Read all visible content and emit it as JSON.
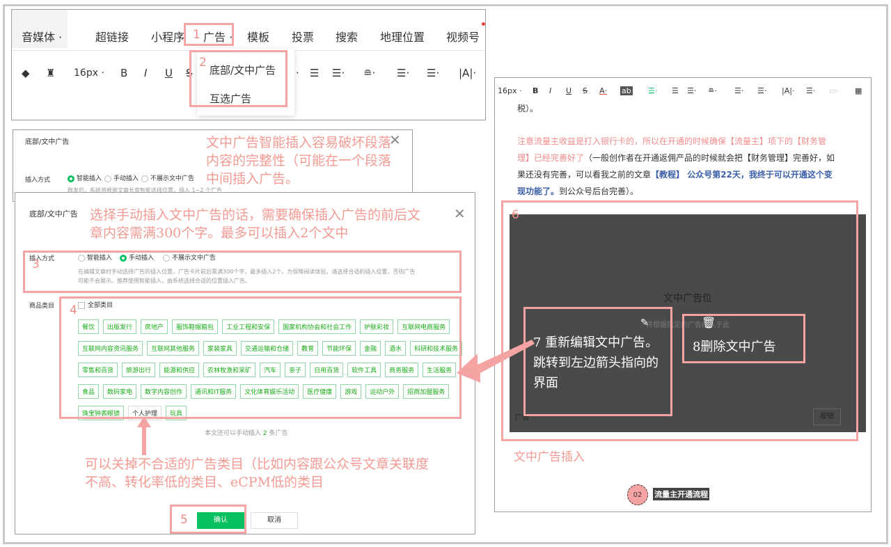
{
  "toolbar_top": {
    "menu": [
      "音媒体 ·",
      "超链接",
      "小程序",
      "广告 ·",
      "模板",
      "投票",
      "搜索",
      "地理位置",
      "视频号"
    ],
    "font_size": "16px ·",
    "bold": "B",
    "italic": "I",
    "underline": "U",
    "strike": "S"
  },
  "ad_dropdown": {
    "items": [
      "底部/文中广告",
      "互选广告"
    ]
  },
  "dialog_small": {
    "title": "底部/文中广告",
    "insert_label": "插入方式",
    "options": [
      "智能插入",
      "手动插入",
      "不展示文中广告"
    ],
    "hint": "群发后，系统将根据文章长度智能选择位置，插入 1~2 个广告"
  },
  "dialog_big": {
    "title": "底部/文中广告",
    "insert_label": "插入方式",
    "options": [
      "智能插入",
      "手动插入",
      "不展示文中广告"
    ],
    "hint_line1": "在编辑文章时手动选择广告的插入位置，广告卡片前后需满300个字，最多插入2个。为保障阅读体验，请选择合适的插入位置，否则广告",
    "hint_line2": "可能不会展示。推荐使用智能插入，由系统选择合适的位置插入广告。",
    "category_label": "商品类目",
    "all_categories": "全部类目",
    "tags": [
      [
        "餐饮",
        "出版发行",
        "房地产",
        "服饰鞋帽箱包",
        "工业工程和安保",
        "国家机构协会和社会工作",
        "护肤彩妆",
        "互联网电商服务"
      ],
      [
        "互联网内容资讯服务",
        "互联网其他服务",
        "家装家具",
        "交通运输和仓储",
        "教育",
        "节能环保",
        "金融",
        "酒水",
        "科研和技术服务"
      ],
      [
        "零售和百货",
        "旅游出行",
        "能源和供应",
        "农林牧渔和采矿",
        "汽车",
        "亲子",
        "日用百货",
        "软件工具",
        "商务服务",
        "生活服务"
      ],
      [
        "食品",
        "数码家电",
        "数字内容创作",
        "通讯和IT服务",
        "文化体育娱乐活动",
        "医疗健康",
        "游戏",
        "运动户外",
        "招商加盟服务"
      ],
      [
        "珠宝钟表眼镜",
        "个人护理",
        "玩具"
      ]
    ],
    "remaining_prefix": "本文还可以手动插入",
    "remaining_count": "2",
    "remaining_suffix": "条广告",
    "confirm": "确认",
    "cancel": "取消"
  },
  "right_panel": {
    "font_size": "16px ·",
    "tail": "税）。",
    "para1_red": "注意流量主收益是打入银行卡的，所以在开通的时候确保【流量主】项下的【财务管理】已经完善好了",
    "para1_rest": "（一般创作者在开通返佣产品的时候就会把【财务管理】完善好，如果还没有完善，可以看我之前的文章",
    "para1_blue": "【教程】 公众号第22天，我终于可以开通这个变现功能了。",
    "para1_end": "到公众号后台完善）。",
    "ad_slot_title": "文中广告位",
    "ad_slot_sub": "将根据指定的广告插入于此",
    "ad_slot_bottom_left": "广告",
    "ad_slot_button": "按钮",
    "step_num": "02",
    "step_label": "流量主开通流程"
  },
  "annotations": {
    "n1": "1",
    "n2": "2",
    "n3": "3",
    "n4": "4",
    "n5": "5",
    "n6": "6",
    "smart_note": "文中广告智能插入容易破坏段落内容的完整性（可能在一个段落中间插入广告。",
    "manual_note": "选择手动插入文中广告的话，需要确保插入广告的前后文章内容需满300个字。最多可以插入2个文中",
    "category_note": "可以关掉不合适的广告类目（比如内容跟公众号文章关联度不高、转化率低的类目、eCPM低的类目",
    "edit_note": "7 重新编辑文中广告。跳转到左边箭头指向的界面",
    "delete_note": "8删除文中广告",
    "insert_caption": "文中广告插入"
  }
}
